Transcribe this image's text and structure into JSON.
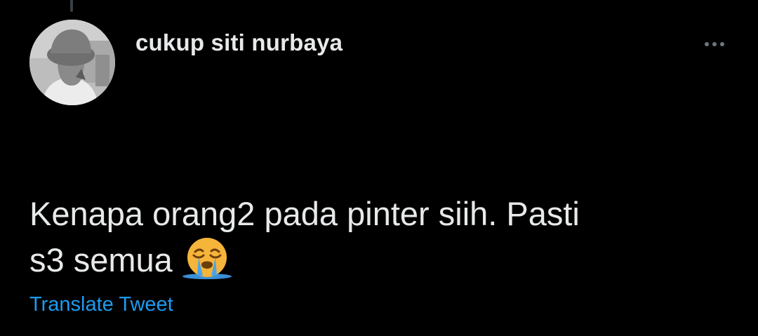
{
  "tweet": {
    "display_name": "cukup siti nurbaya",
    "text_line_1": "Kenapa orang2 pada pinter siih. Pasti",
    "text_line_2": "s3 semua",
    "emoji": "loudly-crying-face-emoji",
    "translate_label": "Translate Tweet"
  },
  "icons": {
    "more": "more-options-icon",
    "avatar": "profile-avatar"
  },
  "colors": {
    "background": "#000000",
    "text": "#e7e9ea",
    "link": "#1d9bf0",
    "muted": "#6e767d"
  }
}
